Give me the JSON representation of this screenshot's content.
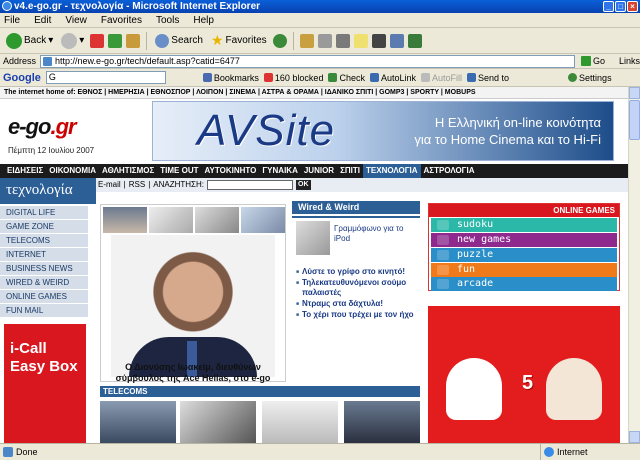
{
  "window": {
    "title": "v4.e-go.gr - τεχνολογία - Microsoft Internet Explorer"
  },
  "menu": [
    "File",
    "Edit",
    "View",
    "Favorites",
    "Tools",
    "Help"
  ],
  "toolbar": {
    "back": "Back",
    "search": "Search",
    "favorites": "Favorites"
  },
  "address": {
    "label": "Address",
    "url": "http://new.e-go.gr/tech/default.asp?catid=6477",
    "go": "Go",
    "links": "Links"
  },
  "googlebar": {
    "logo": "Google",
    "search_placeholder": "G",
    "bookmarks": "Bookmarks",
    "blocked": "160 blocked",
    "check": "Check",
    "autolink": "AutoLink",
    "autofill": "AutoFill",
    "sendto": "Send to",
    "settings": "Settings"
  },
  "page": {
    "topstrip": "The internet home of: ΕΘΝΟΣ | ΗΜΕΡΗΣΙΑ | ΕΘΝΟΣΠΟΡ | ΛΟΙΠΟΝ | ΣΙΝΕΜΑ | ΑΣΤΡΑ & ΟΡΑΜΑ | ΙΔΑΝΙΚΟ ΣΠΙΤΙ | GOMP3 | SPORTY | MOBUPS",
    "logo": "e-go",
    "logo_tld": ".gr",
    "date": "Πέμπτη 12 Ιουλίου 2007",
    "banner": {
      "brand": "AVSite",
      "line1": "Η Ελληνική on-line κοινότητα",
      "line2": "για το Home Cinema και το Hi-Fi"
    },
    "nav": [
      "ΕΙΔΗΣΕΙΣ",
      "ΟΙΚΟΝΟΜΙΑ",
      "ΑΘΛΗΤΙΣΜΟΣ",
      "TIME OUT",
      "ΑΥΤΟΚΙΝΗΤΟ",
      "ΓΥΝΑΙΚΑ",
      "JUNIOR",
      "ΣΠΙΤΙ",
      "ΤΕΧΝΟΛΟΓΙΑ",
      "ΑΣΤΡΟΛΟΓΙΑ"
    ],
    "section_title": "τεχνολογία",
    "searchrow": {
      "email": "E-mail",
      "rss": "RSS",
      "search_label": "ΑΝΑΖΗΤΗΣΗ:",
      "ok": "OK"
    },
    "side_menu": [
      "DIGITAL LIFE",
      "GAME ZONE",
      "TELECOMS",
      "INTERNET",
      "BUSINESS NEWS",
      "WIRED & WEIRD",
      "ONLINE GAMES",
      "FUN MAIL"
    ],
    "ad_ical": {
      "line1": "i-Call",
      "line2": "Easy Box"
    },
    "main_caption": "Ο Διονύσης Ιωακείμ, διευθύνων σύμβουλος της Ace Hellas, στο e-go",
    "wired": {
      "title": "Wired & Weird",
      "lead": "Γραμμόφωνο για το iPod",
      "items": [
        "Λύστε το γρίφο στο κινητό!",
        "Τηλεκατευθυνόμενοι σούμο παλαιστές",
        "Ντραμς στα δάχτυλα!",
        "Το χέρι που τρέχει με τον ήχο"
      ]
    },
    "online_games": {
      "title": "ONLINE GAMES",
      "items": [
        "sudoku",
        "new games",
        "puzzle",
        "fun",
        "arcade"
      ]
    },
    "telecoms_title": "TELECOMS",
    "red_ad_number": "5"
  },
  "status": {
    "text": "Done",
    "zone": "Internet"
  },
  "colors": {
    "accent": "#2c5f96",
    "red": "#d9171f"
  }
}
